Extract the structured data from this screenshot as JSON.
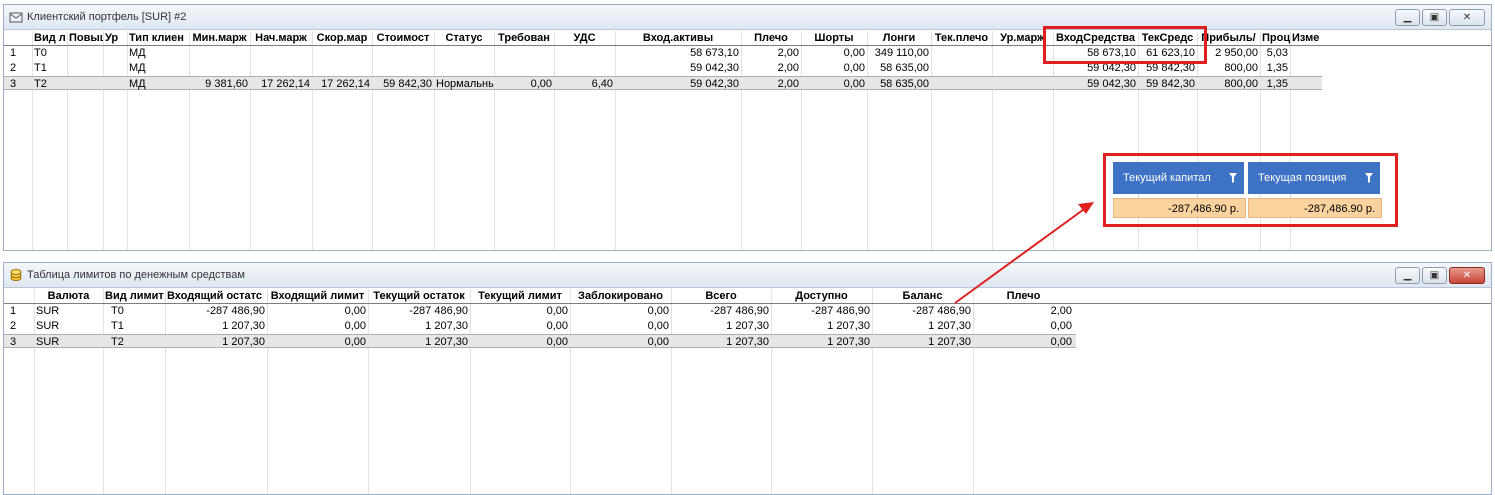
{
  "win1": {
    "title": "Клиентский портфель [SUR] #2",
    "headers": [
      "Вид л",
      "Повыш",
      "Ур",
      "Тип клиен",
      "Мин.марж",
      "Нач.марж",
      "Скор.мар",
      "Стоимост",
      "Статус",
      "Требован",
      "УДС",
      "Вход.активы",
      "Плечо",
      "Шорты",
      "Лонги",
      "Тек.плечо",
      "Ур.марж",
      "ВходСредства",
      "ТекСредс",
      "Прибыль/",
      "Проц",
      "Изме"
    ],
    "rows": [
      {
        "idx": "1",
        "cells": [
          "T0",
          "",
          "",
          "МД",
          "",
          "",
          "",
          "",
          "",
          "",
          "",
          "58 673,10",
          "2,00",
          "0,00",
          "349 110,00",
          "",
          "",
          "58 673,10",
          "61 623,10",
          "2 950,00",
          "5,03"
        ]
      },
      {
        "idx": "2",
        "cells": [
          "T1",
          "",
          "",
          "МД",
          "",
          "",
          "",
          "",
          "",
          "",
          "",
          "59 042,30",
          "2,00",
          "0,00",
          "58 635,00",
          "",
          "",
          "59 042,30",
          "59 842,30",
          "800,00",
          "1,35"
        ]
      },
      {
        "idx": "3",
        "cells": [
          "T2",
          "",
          "",
          "МД",
          "9 381,60",
          "17 262,14",
          "17 262,14",
          "59 842,30",
          "Нормальны",
          "0,00",
          "6,40",
          "59 042,30",
          "2,00",
          "0,00",
          "58 635,00",
          "",
          "",
          "59 042,30",
          "59 842,30",
          "800,00",
          "1,35"
        ]
      }
    ]
  },
  "popup": {
    "col1": "Текущий капитал",
    "col2": "Текущая позиция",
    "val1": "-287,486.90 р.",
    "val2": "-287,486.90 р."
  },
  "win2": {
    "title": "Таблица лимитов по денежным средствам",
    "headers": [
      "Валюта",
      "Вид лимит",
      "Входящий остатс",
      "Входящий лимит",
      "Текущий остаток",
      "Текущий лимит",
      "Заблокировано",
      "Всего",
      "Доступно",
      "Баланс",
      "Плечо"
    ],
    "rows": [
      {
        "idx": "1",
        "cells": [
          "SUR",
          "T0",
          "-287 486,90",
          "0,00",
          "-287 486,90",
          "0,00",
          "0,00",
          "-287 486,90",
          "-287 486,90",
          "-287 486,90",
          "2,00"
        ]
      },
      {
        "idx": "2",
        "cells": [
          "SUR",
          "T1",
          "1 207,30",
          "0,00",
          "1 207,30",
          "0,00",
          "0,00",
          "1 207,30",
          "1 207,30",
          "1 207,30",
          "0,00"
        ]
      },
      {
        "idx": "3",
        "cells": [
          "SUR",
          "T2",
          "1 207,30",
          "0,00",
          "1 207,30",
          "0,00",
          "0,00",
          "1 207,30",
          "1 207,30",
          "1 207,30",
          "0,00"
        ]
      }
    ]
  },
  "colors": {
    "highlight": "#e02020",
    "popup_header": "#3e72c4",
    "popup_value_bg": "#fbd39e"
  },
  "icons": {
    "win1": "portfolio-icon",
    "win2": "coins-icon",
    "filter": "filter-icon"
  }
}
